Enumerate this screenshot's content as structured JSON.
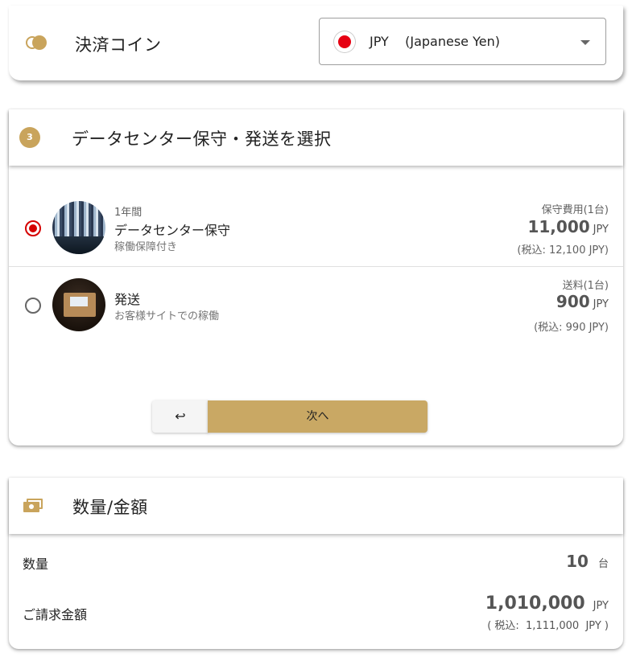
{
  "colors": {
    "accent": "#c9a45c",
    "radio_selected": "#d50000",
    "jpy_flag": "#e60012"
  },
  "coin": {
    "title": "決済コイン",
    "icon": "coins-icon",
    "select": {
      "value": "JPY    (Japanese Yen)",
      "icon": "japan-flag-icon"
    }
  },
  "selection": {
    "step": "3",
    "title": "データセンター保守・発送を選択",
    "options": [
      {
        "selected": true,
        "period": "1年間",
        "name": "データセンター保守",
        "description": "稼働保障付き",
        "price_label": "保守費用(1台)",
        "price": "11,000",
        "currency": "JPY",
        "price_tax": "(税込: 12,100 JPY)"
      },
      {
        "selected": false,
        "name": "発送",
        "description": "お客様サイトでの稼働",
        "price_label": "送料(1台)",
        "price": "900",
        "currency": "JPY",
        "price_tax": "(税込: 990 JPY)"
      }
    ],
    "back_label": "↩",
    "next_label": "次へ"
  },
  "summary": {
    "title": "数量/金額",
    "icon": "money-icon",
    "quantity_label": "数量",
    "quantity_value": "10",
    "quantity_unit": "台",
    "total_label": "ご請求金額",
    "total_value": "1,010,000",
    "total_currency": "JPY",
    "total_tax": "( 税込:  1,111,000  JPY )"
  }
}
